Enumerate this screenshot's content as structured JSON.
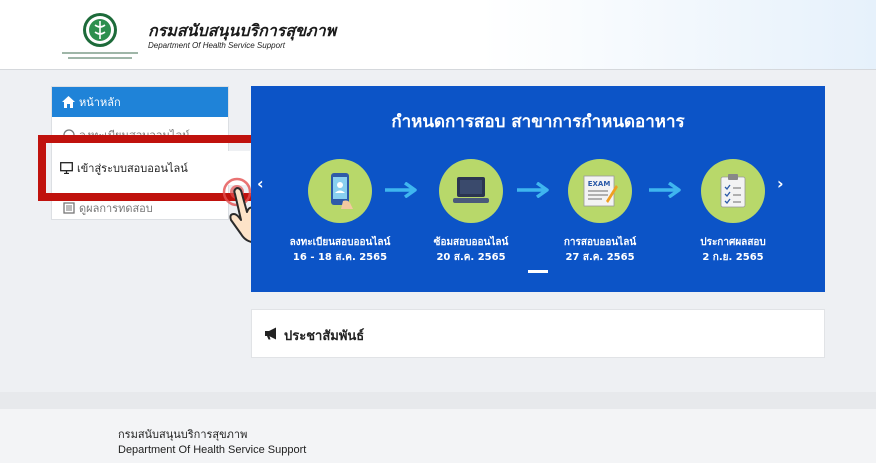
{
  "header": {
    "org_name_th": "กรมสนับสนุนบริการสุขภาพ",
    "org_name_en": "Department Of Health Service Support"
  },
  "sidebar": {
    "items": [
      {
        "label": "หน้าหลัก",
        "icon": "home-icon"
      },
      {
        "label": "ลงทะเบียนสอบออนไลน์",
        "icon": "register-icon"
      },
      {
        "label": "เข้าสู่ระบบสอบออนไลน์",
        "icon": "monitor-icon"
      },
      {
        "label": "ดูผลการทดสอบ",
        "icon": "results-icon"
      }
    ]
  },
  "banner": {
    "title": "กำหนดการสอบ สาขาการกำหนดอาหาร",
    "steps": [
      {
        "label": "ลงทะเบียนสอบออนไลน์",
        "date": "16 - 18 ส.ค. 2565"
      },
      {
        "label": "ซ้อมสอบออนไลน์",
        "date": "20 ส.ค. 2565"
      },
      {
        "label": "การสอบออนไลน์",
        "date": "27 ส.ค. 2565"
      },
      {
        "label": "ประกาศผลสอบ",
        "date": "2 ก.ย. 2565"
      }
    ],
    "exam_icon_text": "EXAM"
  },
  "news": {
    "title": "ประชาสัมพันธ์"
  },
  "footer": {
    "org_name_th": "กรมสนับสนุนบริการสุขภาพ",
    "org_name_en": "Department Of Health Service Support"
  },
  "colors": {
    "banner": "#0c54c7",
    "sidebar_active": "#1f83d8",
    "highlight": "#c0120d",
    "step_circle": "#b8d86a"
  }
}
